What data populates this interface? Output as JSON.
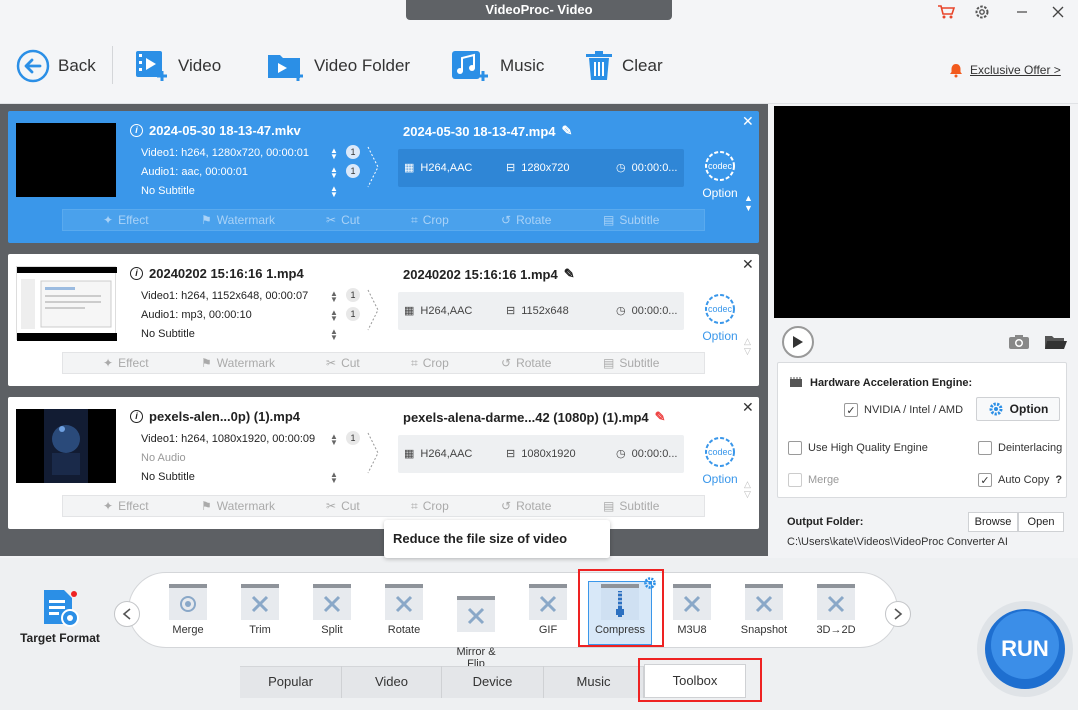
{
  "window": {
    "title": "VideoProc- Video"
  },
  "toolbar": {
    "back": "Back",
    "video": "Video",
    "video_folder": "Video Folder",
    "music": "Music",
    "clear": "Clear",
    "offer": "Exclusive Offer >"
  },
  "files": [
    {
      "input_name": "2024-05-30 18-13-47.mkv",
      "video_info": "Video1: h264, 1280x720, 00:00:01",
      "audio_info": "Audio1: aac, 00:00:01",
      "subtitle_info": "No Subtitle",
      "video_count": "1",
      "audio_count": "1",
      "output_name": "2024-05-30 18-13-47.mp4",
      "codec": "H264,AAC",
      "resolution": "1280x720",
      "duration": "00:00:0...",
      "codec_option": "Option"
    },
    {
      "input_name": "20240202 15:16:16 1.mp4",
      "video_info": "Video1: h264, 1152x648, 00:00:07",
      "audio_info": "Audio1: mp3, 00:00:10",
      "subtitle_info": "No Subtitle",
      "video_count": "1",
      "audio_count": "1",
      "output_name": "20240202 15:16:16 1.mp4",
      "codec": "H264,AAC",
      "resolution": "1152x648",
      "duration": "00:00:0...",
      "codec_option": "Option"
    },
    {
      "input_name": "pexels-alen...0p) (1).mp4",
      "video_info": "Video1: h264, 1080x1920, 00:00:09",
      "audio_info": "No Audio",
      "subtitle_info": "No Subtitle",
      "video_count": "1",
      "output_name": "pexels-alena-darme...42 (1080p) (1).mp4",
      "codec": "H264,AAC",
      "resolution": "1080x1920",
      "duration": "00:00:0...",
      "codec_option": "Option"
    }
  ],
  "edit_actions": [
    "Effect",
    "Watermark",
    "Cut",
    "Crop",
    "Rotate",
    "Subtitle"
  ],
  "settings": {
    "hw_title": "Hardware Acceleration Engine:",
    "nvidia": "NVIDIA / Intel / AMD",
    "option": "Option",
    "high_quality": "Use High Quality Engine",
    "deinterlacing": "Deinterlacing",
    "merge": "Merge",
    "auto_copy": "Auto Copy",
    "help": "?",
    "output_folder_label": "Output Folder:",
    "browse": "Browse",
    "open": "Open",
    "output_path": "C:\\Users\\kate\\Videos\\VideoProc Converter AI"
  },
  "tooltip": "Reduce the file size of video",
  "target_format": "Target Format",
  "tools": [
    {
      "label": "Merge",
      "icon": "merge-icon"
    },
    {
      "label": "Trim",
      "icon": "trim-icon"
    },
    {
      "label": "Split",
      "icon": "split-icon"
    },
    {
      "label": "Rotate",
      "icon": "rotate-icon"
    },
    {
      "label": "Mirror &\nFlip",
      "icon": "mirror-flip-icon"
    },
    {
      "label": "GIF",
      "icon": "gif-icon"
    },
    {
      "label": "Compress",
      "icon": "compress-icon"
    },
    {
      "label": "M3U8",
      "icon": "m3u8-icon"
    },
    {
      "label": "Snapshot",
      "icon": "snapshot-icon"
    },
    {
      "label": "3D→2D",
      "icon": "3d-2d-icon"
    }
  ],
  "tabs": [
    "Popular",
    "Video",
    "Device",
    "Music",
    "Toolbox"
  ],
  "run": "RUN",
  "colors": {
    "accent": "#3a97ea",
    "highlight": "#e22222",
    "offer_bell": "#f25a1d"
  }
}
